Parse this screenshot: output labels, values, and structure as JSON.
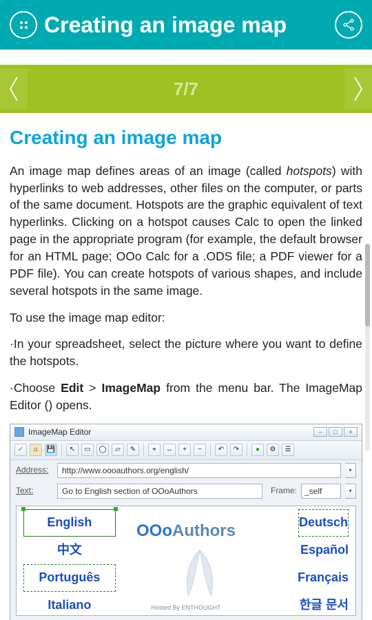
{
  "header": {
    "title": "Creating an image map"
  },
  "pager": {
    "current": 7,
    "total": 7,
    "display": "7/7"
  },
  "article": {
    "heading": "Creating an image map",
    "p1_pre": "An image map defines areas of an image (called ",
    "p1_em": "hotspots",
    "p1_post": ") with hyperlinks to web addresses, other files on the computer, or parts of the same document. Hotspots are the graphic equivalent of text hyperlinks. Clicking on a hotspot causes Calc to open the linked page in the appropriate program (for example, the default browser for an HTML page; OOo Calc for a .ODS file; a PDF viewer for a PDF file). You can create hotspots of various shapes, and include several hotspots in the same image.",
    "p2": "To use the image map editor:",
    "p3": "·In your spreadsheet, select the picture where you want to define the hotspots.",
    "p4_pre": "·Choose ",
    "p4_b1": "Edit",
    "p4_mid": " > ",
    "p4_b2": "ImageMap",
    "p4_post": " from the menu bar. The ImageMap Editor () opens."
  },
  "editor": {
    "window_title": "ImageMap Editor",
    "address_label": "Address:",
    "address_value": "http://www.oooauthors.org/english/",
    "text_label": "Text:",
    "text_value": "Go to English section of OOoAuthors",
    "frame_label": "Frame:",
    "frame_value": "_self",
    "langs": {
      "english": "English",
      "chinese": "中文",
      "portugues": "Português",
      "italiano": "Italiano",
      "deutsch": "Deutsch",
      "espanol": "Español",
      "francais": "Français",
      "korean": "한글 문서"
    },
    "logo_pre": "OOo",
    "logo_post": "Authors",
    "hosted_by": "Hosted By ENTHOUGHT"
  }
}
